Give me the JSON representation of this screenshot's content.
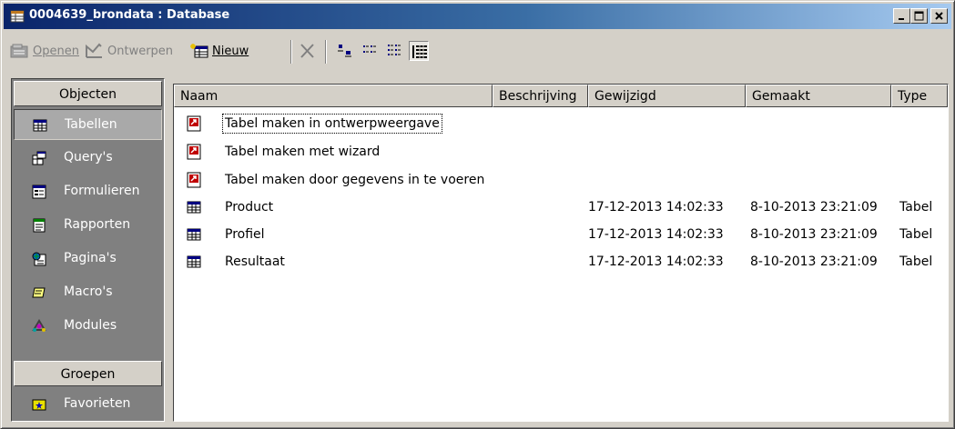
{
  "window": {
    "title": "0004639_brondata : Database",
    "icon": "database-window-icon"
  },
  "toolbar": {
    "open_label": "Openen",
    "design_label": "Ontwerpen",
    "new_label": "Nieuw",
    "delete_icon": "delete-x-icon",
    "views": [
      "large-icons",
      "small-icons",
      "list",
      "details"
    ],
    "active_view": "details"
  },
  "sidebar": {
    "objects_header": "Objecten",
    "items": [
      {
        "label": "Tabellen",
        "icon": "table-icon",
        "selected": true
      },
      {
        "label": "Query's",
        "icon": "query-icon",
        "selected": false
      },
      {
        "label": "Formulieren",
        "icon": "form-icon",
        "selected": false
      },
      {
        "label": "Rapporten",
        "icon": "report-icon",
        "selected": false
      },
      {
        "label": "Pagina's",
        "icon": "page-icon",
        "selected": false
      },
      {
        "label": "Macro's",
        "icon": "macro-icon",
        "selected": false
      },
      {
        "label": "Modules",
        "icon": "module-icon",
        "selected": false
      }
    ],
    "groups_header": "Groepen",
    "groups": [
      {
        "label": "Favorieten",
        "icon": "favorites-icon"
      }
    ]
  },
  "list": {
    "columns": [
      "Naam",
      "Beschrijving",
      "Gewijzigd",
      "Gemaakt",
      "Type"
    ],
    "rows": [
      {
        "name": "Tabel maken in ontwerpweergave",
        "description": "",
        "modified": "",
        "created": "",
        "type": "",
        "icon": "shortcut-icon",
        "focused": true
      },
      {
        "name": "Tabel maken met wizard",
        "description": "",
        "modified": "",
        "created": "",
        "type": "",
        "icon": "shortcut-icon",
        "focused": false
      },
      {
        "name": "Tabel maken door gegevens in te voeren",
        "description": "",
        "modified": "",
        "created": "",
        "type": "",
        "icon": "shortcut-icon",
        "focused": false
      },
      {
        "name": "Product",
        "description": "",
        "modified": "17-12-2013 14:02:33",
        "created": "8-10-2013 23:21:09",
        "type": "Tabel",
        "icon": "table-icon",
        "focused": false
      },
      {
        "name": "Profiel",
        "description": "",
        "modified": "17-12-2013 14:02:33",
        "created": "8-10-2013 23:21:09",
        "type": "Tabel",
        "icon": "table-icon",
        "focused": false
      },
      {
        "name": "Resultaat",
        "description": "",
        "modified": "17-12-2013 14:02:33",
        "created": "8-10-2013 23:21:09",
        "type": "Tabel",
        "icon": "table-icon",
        "focused": false
      }
    ]
  },
  "colors": {
    "titlebar_start": "#0a246a",
    "titlebar_end": "#a6caf0",
    "face": "#d4d0c8",
    "sidebar_bg": "#808080"
  }
}
